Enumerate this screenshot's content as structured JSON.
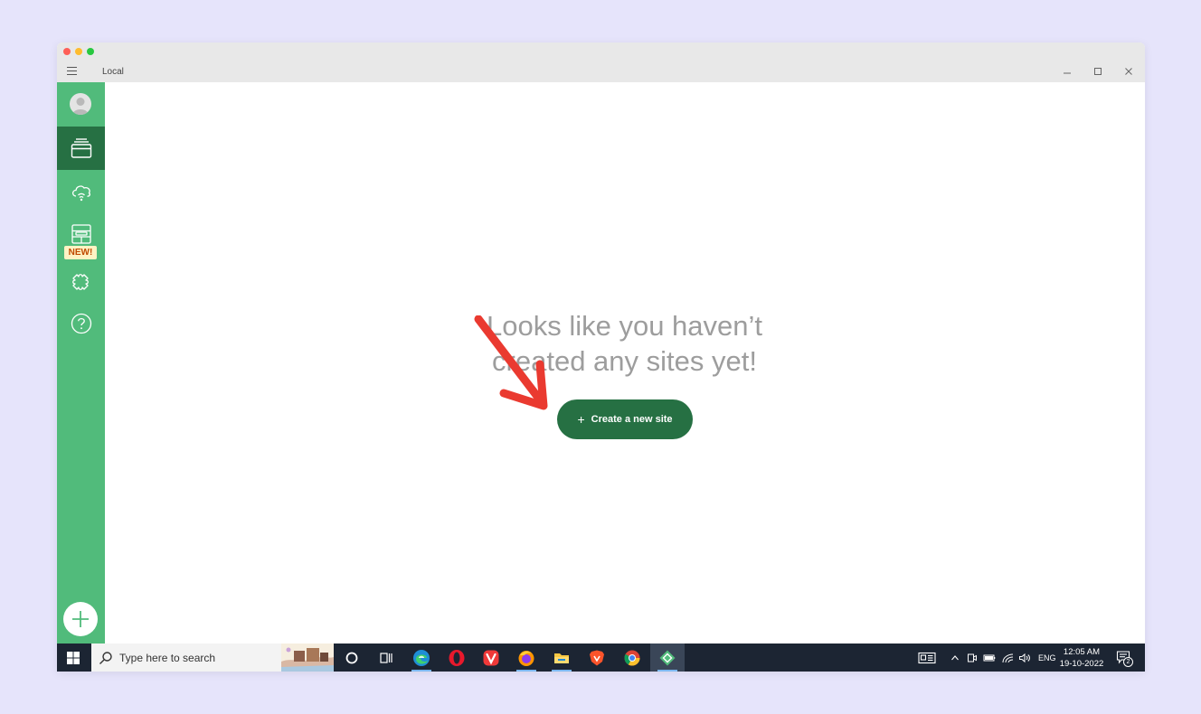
{
  "window": {
    "title": "Local"
  },
  "sidebar": {
    "new_badge": "NEW!"
  },
  "main": {
    "empty_line1": "Looks like you haven’t",
    "empty_line2": "created any sites yet!",
    "create_button_label": "Create a new site",
    "create_button_plus": "+"
  },
  "taskbar": {
    "search_placeholder": "Type here to search",
    "language": "ENG",
    "time": "12:05 AM",
    "date": "19-10-2022",
    "notification_count": "2"
  },
  "colors": {
    "sidebar_green": "#51bb7b",
    "dark_green": "#267043",
    "arrow_red": "#ea3a30",
    "background": "#e6e4fb"
  }
}
